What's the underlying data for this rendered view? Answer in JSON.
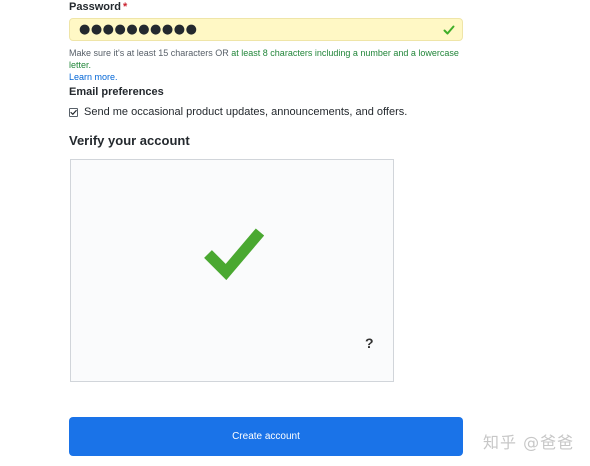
{
  "password": {
    "label": "Password",
    "required_mark": "*",
    "masked_value": "●●●●●●●●●●",
    "valid": true,
    "hint_prefix": "Make sure it's at least 15 characters OR ",
    "hint_ok": "at least 8 characters including a number and a lowercase letter.",
    "learn_more": "Learn more."
  },
  "email_preferences": {
    "label": "Email preferences",
    "checkbox_checked": true,
    "checkbox_text": "Send me occasional product updates, announcements, and offers."
  },
  "verify": {
    "title": "Verify your account",
    "help_glyph": "?"
  },
  "submit": {
    "label": "Create account"
  },
  "watermark": {
    "text": "知乎 @爸爸"
  },
  "colors": {
    "success_green": "#3fae29",
    "button_blue": "#1a73e8",
    "input_valid_bg": "#fff8c5"
  }
}
